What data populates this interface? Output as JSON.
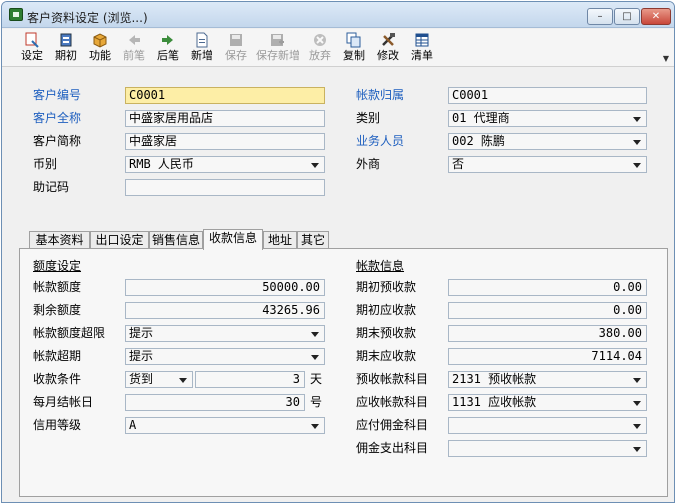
{
  "window": {
    "title": "客户资料设定 (浏览...)",
    "min_label": "–",
    "max_label": "□",
    "close_label": "✕"
  },
  "toolbar": {
    "buttons": [
      {
        "label": "设定",
        "icon": "settings-icon",
        "enabled": true
      },
      {
        "label": "期初",
        "icon": "period-icon",
        "enabled": true
      },
      {
        "label": "功能",
        "icon": "function-box-icon",
        "enabled": true
      },
      {
        "label": "前笔",
        "icon": "arrow-left-icon",
        "enabled": false
      },
      {
        "label": "后笔",
        "icon": "arrow-right-icon",
        "enabled": true
      },
      {
        "label": "新增",
        "icon": "new-doc-icon",
        "enabled": true
      },
      {
        "label": "保存",
        "icon": "save-icon",
        "enabled": false
      },
      {
        "label": "保存新增",
        "icon": "save-new-icon",
        "enabled": false
      },
      {
        "label": "放弃",
        "icon": "discard-icon",
        "enabled": false
      },
      {
        "label": "复制",
        "icon": "copy-icon",
        "enabled": true
      },
      {
        "label": "修改",
        "icon": "edit-tools-icon",
        "enabled": true
      },
      {
        "label": "清单",
        "icon": "list-icon",
        "enabled": true
      }
    ],
    "chevron": "▼"
  },
  "header": {
    "customer_code": {
      "label": "客户编号",
      "value": "C0001"
    },
    "customer_fullname": {
      "label": "客户全称",
      "value": "中盛家居用品店"
    },
    "customer_shortname": {
      "label": "客户简称",
      "value": "中盛家居"
    },
    "currency": {
      "label": "币别",
      "value": "RMB 人民币"
    },
    "memo_code": {
      "label": "助记码",
      "value": ""
    },
    "account_owner": {
      "label": "帐款归属",
      "value": "C0001"
    },
    "category": {
      "label": "类别",
      "value": "01 代理商"
    },
    "salesperson": {
      "label": "业务人员",
      "value": "002 陈鹏"
    },
    "foreign": {
      "label": "外商",
      "value": "否"
    }
  },
  "tabs": [
    {
      "label": "基本资料"
    },
    {
      "label": "出口设定"
    },
    {
      "label": "销售信息"
    },
    {
      "label": "收款信息"
    },
    {
      "label": "地址"
    },
    {
      "label": "其它"
    }
  ],
  "credit": {
    "section_title": "额度设定",
    "credit_limit": {
      "label": "帐款额度",
      "value": "50000.00"
    },
    "remaining": {
      "label": "剩余额度",
      "value": "43265.96"
    },
    "over_limit": {
      "label": "帐款额度超限",
      "value": "提示"
    },
    "overdue": {
      "label": "帐款超期",
      "value": "提示"
    },
    "payment_terms": {
      "label": "收款条件",
      "value": "货到",
      "days": "3",
      "unit": "天"
    },
    "monthly_close": {
      "label": "每月结帐日",
      "value": "30",
      "unit": "号"
    },
    "credit_grade": {
      "label": "信用等级",
      "value": "A"
    }
  },
  "account": {
    "section_title": "帐款信息",
    "opening_prepaid": {
      "label": "期初预收款",
      "value": "0.00"
    },
    "opening_receivable": {
      "label": "期初应收款",
      "value": "0.00"
    },
    "ending_prepaid": {
      "label": "期末预收款",
      "value": "380.00"
    },
    "ending_receivable": {
      "label": "期末应收款",
      "value": "7114.04"
    },
    "prepaid_subject": {
      "label": "预收帐款科目",
      "value": "2131 预收帐款"
    },
    "receivable_subject": {
      "label": "应收帐款科目",
      "value": "1131 应收帐款"
    },
    "commission_payable": {
      "label": "应付佣金科目",
      "value": ""
    },
    "commission_expense": {
      "label": "佣金支出科目",
      "value": ""
    }
  },
  "colors": {
    "accent_label": "#1e5fbf",
    "highlight_field": "#fdeea6"
  }
}
